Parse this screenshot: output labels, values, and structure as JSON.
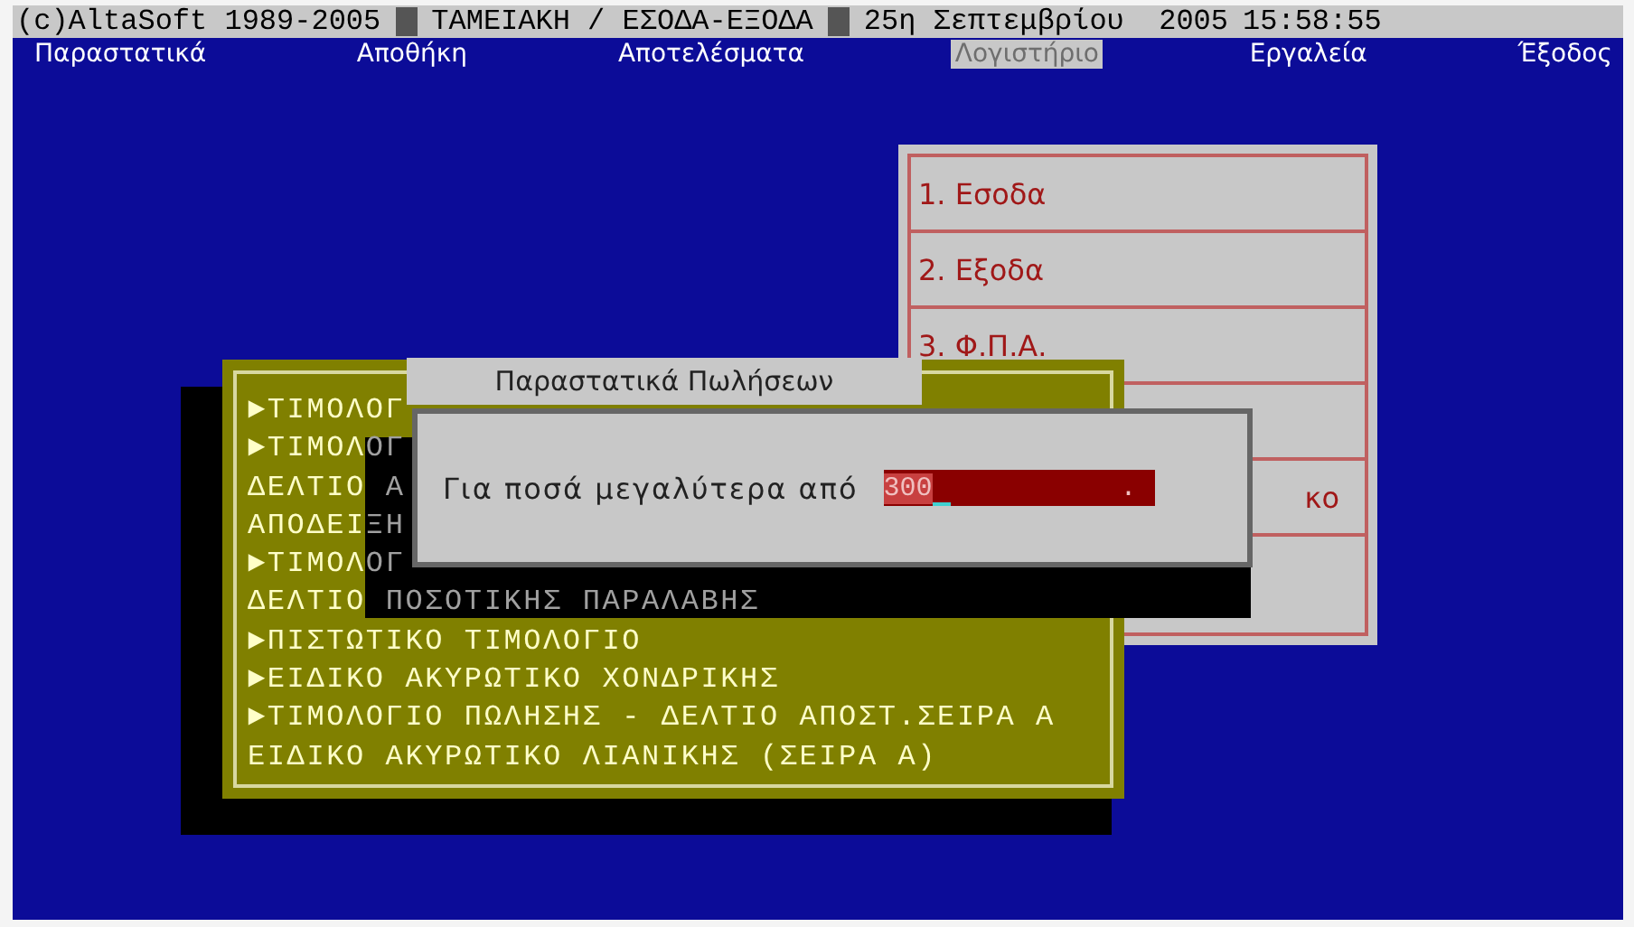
{
  "status_strip": {
    "copyright": "(c)AltaSoft 1989-2005",
    "module": "ΤΑΜΕΙΑΚΗ / ΕΣΟΔΑ-ΕΞΟΔΑ",
    "date": "25η Σεπτεμβρίου  2005",
    "time": "15:58:55"
  },
  "menu_bar": [
    {
      "label": "Παραστατικά",
      "disabled": false
    },
    {
      "label": "Αποθήκη",
      "disabled": false
    },
    {
      "label": "Αποτελέσματα",
      "disabled": false
    },
    {
      "label": "Λογιστήριο",
      "disabled": true
    },
    {
      "label": "Εργαλεία",
      "disabled": false
    },
    {
      "label": "Έξοδος",
      "disabled": false
    }
  ],
  "report_menu": {
    "items": [
      {
        "kind": "full",
        "label": "1. Εσοδα"
      },
      {
        "kind": "full",
        "label": "2. Εξοδα"
      },
      {
        "kind": "full",
        "label": "3. Φ.Π.Α."
      },
      {
        "kind": "blank"
      },
      {
        "kind": "cut",
        "label": "κο"
      },
      {
        "kind": "blank"
      }
    ]
  },
  "document_list": {
    "items": [
      {
        "text": "►ΤΙΜΟΛΟΓ"
      },
      {
        "text": "►ΤΙΜΟΛ",
        "shaded": "ΟΓ"
      },
      {
        "text": "ΔΕΛΤΙΟ ",
        "shaded": "Α"
      },
      {
        "text": "ΑΠΟΔΕΙ",
        "shaded": "ΞΗ"
      },
      {
        "text": "►ΤΙΜΟΛ",
        "shaded": "ΟΓ"
      },
      {
        "text": "ΔΕΛΤΙΟ ",
        "shaded": "ΠΟΣΟΤΙΚΗΣ ΠΑΡΑΛΑΒΗΣ"
      },
      {
        "text": "►ΠΙΣΤΩΤΙΚΟ ΤΙΜΟΛΟΓΙΟ"
      },
      {
        "text": "►ΕΙΔΙΚΟ ΑΚΥΡΩΤΙΚΟ ΧΟΝΔΡΙΚΗΣ"
      },
      {
        "text": "►ΤΙΜΟΛΟΓΙΟ ΠΩΛΗΣΗΣ - ΔΕΛΤΙΟ ΑΠΟΣΤ.ΣΕΙΡΑ Α"
      },
      {
        "text": "ΕΙΔΙΚΟ ΑΚΥΡΩΤΙΚΟ ΛΙΑΝΙΚΗΣ (ΣΕΙΡΑ Α)"
      }
    ]
  },
  "dialog": {
    "title": "Παραστατικά Πωλήσεων",
    "prompt": "Για ποσά μεγαλύτερα από",
    "value": "300",
    "decimal_mark": "."
  }
}
